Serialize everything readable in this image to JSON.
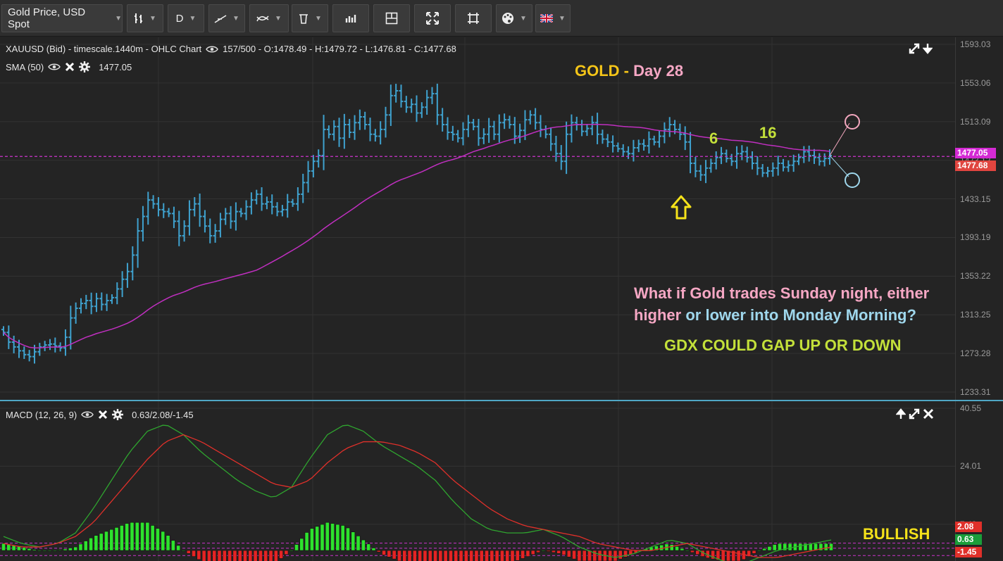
{
  "toolbar": {
    "instrument": "Gold Price, USD Spot",
    "timeframe": "D",
    "icons": [
      "bars-type-icon",
      "trendline-icon",
      "indicators-icon",
      "trash-icon",
      "volume-icon",
      "layout-icon",
      "fullscreen-icon",
      "crop-icon",
      "palette-icon",
      "uk-flag-icon"
    ]
  },
  "price_panel": {
    "header": "XAUUSD (Bid) - timescale.1440m - OHLC Chart",
    "ohlc": "157/500 - O:1478.49 - H:1479.72 - L:1476.81 - C:1477.68",
    "sma_label": "SMA (50)",
    "sma_value": "1477.05",
    "axis_ticks": [
      "1593.03",
      "1553.06",
      "1513.09",
      "1473.12",
      "1433.15",
      "1393.19",
      "1353.22",
      "1313.25",
      "1273.28",
      "1233.31"
    ],
    "tag_sma": "1477.05",
    "tag_close": "1477.68",
    "colors": {
      "bars": "#3fa2cf",
      "sma": "#c02fc0",
      "sma_tag": "#d42ad4",
      "close_tag": "#e0453f",
      "hline": "#cc33cc"
    }
  },
  "macd_panel": {
    "label": "MACD (12, 26, 9)",
    "values": "0.63/2.08/-1.45",
    "axis_ticks": [
      "40.55",
      "24.01",
      "7.48"
    ],
    "tag_signal": "2.08",
    "tag_macd": "0.63",
    "tag_hist": "-1.45",
    "colors": {
      "macd_line": "#2fa52f",
      "signal_line": "#e0302a",
      "hist_pos": "#2ee22e",
      "hist_neg": "#e42424"
    }
  },
  "annotations": {
    "title_gold": "GOLD",
    "title_dash": " - ",
    "title_day": "Day 28",
    "count_6": "6",
    "count_16": "16",
    "question_line1_a": "What if Gold trades Sunday night, either",
    "question_line2_a": "higher",
    "question_line2_b": " or ",
    "question_line2_c": "lower into Monday Morning?",
    "gdx_text": "GDX COULD GAP UP OR DOWN",
    "bullish": "BULLISH"
  },
  "chart_data": [
    {
      "type": "ohlc",
      "title": "XAUUSD (Bid) - timescale.1440m - OHLC Chart",
      "ylim": [
        1233.31,
        1593.03
      ],
      "closes_approx": [
        1295,
        1285,
        1280,
        1276,
        1272,
        1270,
        1275,
        1280,
        1282,
        1283,
        1281,
        1279,
        1290,
        1310,
        1320,
        1325,
        1328,
        1322,
        1330,
        1324,
        1328,
        1331,
        1340,
        1350,
        1358,
        1375,
        1400,
        1415,
        1432,
        1428,
        1422,
        1420,
        1418,
        1410,
        1395,
        1405,
        1422,
        1428,
        1415,
        1405,
        1395,
        1400,
        1412,
        1418,
        1410,
        1420,
        1418,
        1425,
        1432,
        1438,
        1428,
        1430,
        1425,
        1420,
        1422,
        1430,
        1428,
        1438,
        1450,
        1462,
        1472,
        1478,
        1505,
        1500,
        1508,
        1496,
        1510,
        1502,
        1512,
        1518,
        1510,
        1500,
        1498,
        1505,
        1520,
        1540,
        1545,
        1534,
        1528,
        1531,
        1522,
        1528,
        1538,
        1542,
        1520,
        1510,
        1502,
        1500,
        1496,
        1505,
        1512,
        1508,
        1496,
        1500,
        1508,
        1500,
        1512,
        1515,
        1510,
        1498,
        1504,
        1515,
        1520,
        1512,
        1505,
        1500,
        1490,
        1480,
        1472,
        1500,
        1512,
        1510,
        1503,
        1506,
        1512,
        1500,
        1495,
        1492,
        1488,
        1485,
        1482,
        1480,
        1486,
        1490,
        1488,
        1495,
        1492,
        1498,
        1505,
        1510,
        1505,
        1500,
        1492,
        1470,
        1462,
        1458,
        1465,
        1470,
        1476,
        1480,
        1475,
        1472,
        1480,
        1482,
        1476,
        1470,
        1465,
        1460,
        1462,
        1465,
        1470,
        1466,
        1468,
        1472,
        1476,
        1482,
        1478,
        1476,
        1472,
        1475,
        1478
      ],
      "sma50_approx_end": 1477.05,
      "last_bar": {
        "open": 1478.49,
        "high": 1479.72,
        "low": 1476.81,
        "close": 1477.68
      }
    },
    {
      "type": "macd",
      "title": "MACD (12, 26, 9)",
      "ylim": [
        -3,
        40.55
      ],
      "last": {
        "macd": 0.63,
        "signal": 2.08,
        "histogram": -1.45
      },
      "macd_approx": [
        4,
        2,
        1,
        2,
        5,
        12,
        20,
        28,
        34,
        36,
        33,
        28,
        24,
        20,
        17,
        15,
        18,
        26,
        33,
        36,
        34,
        30,
        27,
        24,
        20,
        14,
        9,
        6,
        5,
        5,
        6,
        4,
        1,
        -1,
        -2,
        -1,
        1,
        3,
        2,
        -1,
        -3,
        -4,
        -2,
        0,
        1,
        2,
        3
      ],
      "signal_approx": [
        2,
        1,
        1,
        2,
        4,
        8,
        14,
        20,
        26,
        31,
        33,
        31,
        28,
        25,
        22,
        19,
        18,
        20,
        25,
        29,
        31,
        31,
        30,
        28,
        25,
        20,
        16,
        12,
        9,
        7,
        6,
        5,
        4,
        2,
        1,
        0,
        0,
        1,
        2,
        1,
        0,
        -1,
        -2,
        -2,
        -1,
        0,
        1
      ],
      "histogram_approx": [
        2,
        1,
        0,
        0,
        1,
        4,
        6,
        8,
        8,
        5,
        0,
        -3,
        -4,
        -5,
        -5,
        -4,
        0,
        6,
        8,
        7,
        3,
        -1,
        -3,
        -4,
        -5,
        -6,
        -7,
        -6,
        -4,
        -2,
        0,
        -1,
        -3,
        -3,
        -3,
        -1,
        1,
        2,
        0,
        -2,
        -3,
        -3,
        0,
        2,
        2,
        2,
        2
      ]
    }
  ]
}
